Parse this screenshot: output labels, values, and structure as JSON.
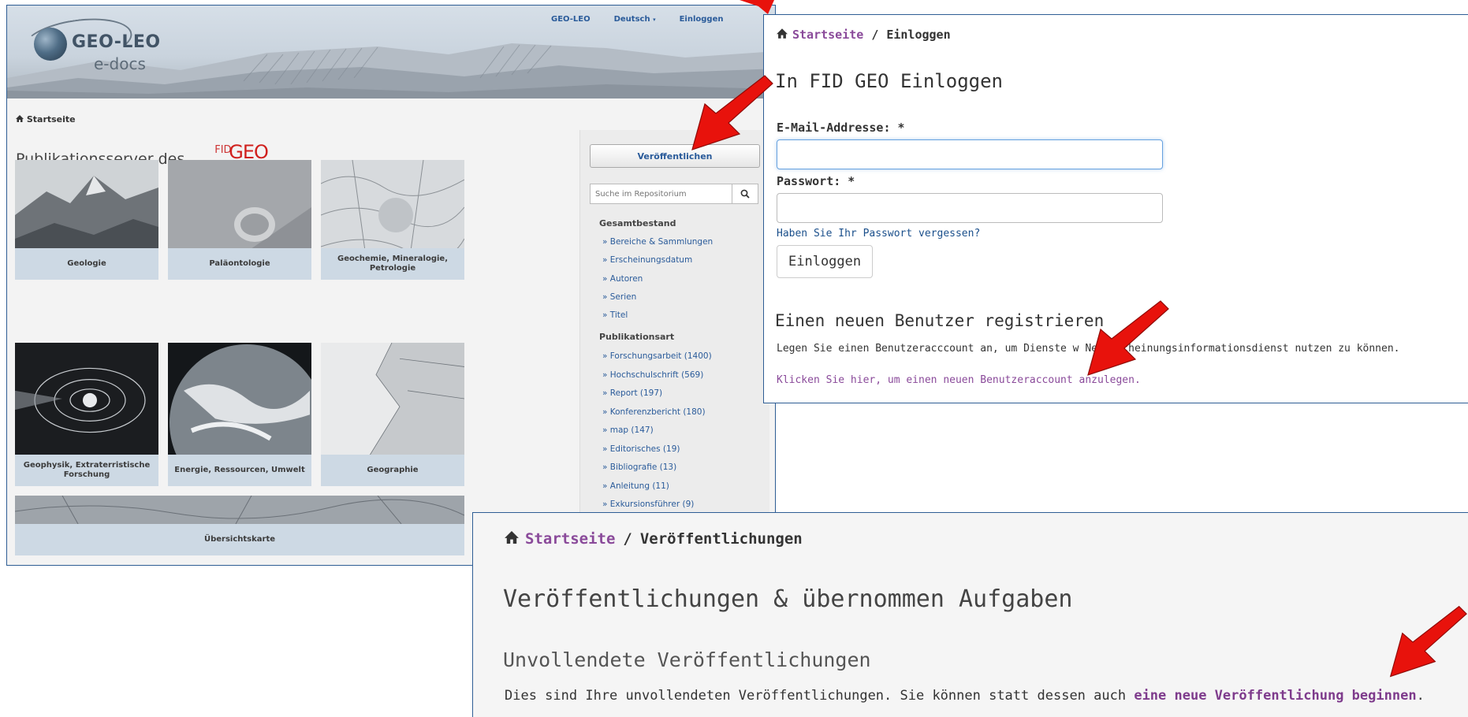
{
  "panel1": {
    "logo": {
      "title": "GEO-LEO",
      "subtitle": "e-docs"
    },
    "topnav": {
      "geo_leo": "GEO-LEO",
      "language": "Deutsch",
      "login": "Einloggen"
    },
    "breadcrumb": "Startseite",
    "heading": "Publikationsserver des",
    "fid_logo": {
      "fid": "FID",
      "geo": "GEO"
    },
    "tiles": [
      {
        "label": "Geologie"
      },
      {
        "label": "Paläontologie"
      },
      {
        "label": "Geochemie, Mineralogie, Petrologie"
      },
      {
        "label": "Geophysik, Extraterristische Forschung"
      },
      {
        "label": "Energie, Ressourcen, Umwelt"
      },
      {
        "label": "Geographie"
      },
      {
        "label": "Übersichtskarte"
      }
    ],
    "sidebar": {
      "publish_label": "Veröffentlichen",
      "search_placeholder": "Suche im Repositorium",
      "section1_title": "Gesamtbestand",
      "section1_items": [
        "» Bereiche & Sammlungen",
        "» Erscheinungsdatum",
        "» Autoren",
        "» Serien",
        "» Titel"
      ],
      "section2_title": "Publikationsart",
      "section2_items": [
        "» Forschungsarbeit (1400)",
        "» Hochschulschrift (569)",
        "» Report (197)",
        "» Konferenzbericht (180)",
        "» map (147)",
        "» Editorisches (19)",
        "» Bibliografie (13)",
        "» Anleitung (11)",
        "» Exkursionsführer (9)"
      ]
    }
  },
  "panel2": {
    "breadcrumb": {
      "home": "Startseite",
      "separator": "/",
      "current": "Einloggen"
    },
    "title": "In FID GEO Einloggen",
    "email_label": "E-Mail-Addresse: *",
    "email_value": "",
    "password_label": "Passwort: *",
    "forgot_link": "Haben Sie Ihr Passwort vergessen?",
    "login_button": "Einloggen",
    "register_title": "Einen neuen Benutzer registrieren",
    "register_desc": "Legen Sie einen Benutzeracccount an, um Dienste w       Neuerscheinungsinformationsdienst nutzen zu können.",
    "register_link": "Klicken Sie hier, um einen neuen Benutzeraccount anzulegen."
  },
  "panel3": {
    "breadcrumb": {
      "home": "Startseite",
      "separator": "/",
      "current": "Veröffentlichungen"
    },
    "title": "Veröffentlichungen & übernommen Aufgaben",
    "subtitle": "Unvollendete Veröffentlichungen",
    "desc_prefix": "Dies sind Ihre unvollendeten Veröffentlichungen. Sie können statt dessen auch ",
    "desc_link": "eine neue Veröffentlichung beginnen",
    "desc_suffix": "."
  },
  "icons": {
    "home": "home-icon",
    "search": "search-icon",
    "caret": "caret-down-icon",
    "arrow": "red-arrow-annotation"
  },
  "colors": {
    "link_blue": "#2a5b9a",
    "visited_purple": "#8a4a9a",
    "arrow_red": "#e8120c",
    "panel_border": "#2e5d94",
    "geo_red": "#d0201d"
  }
}
